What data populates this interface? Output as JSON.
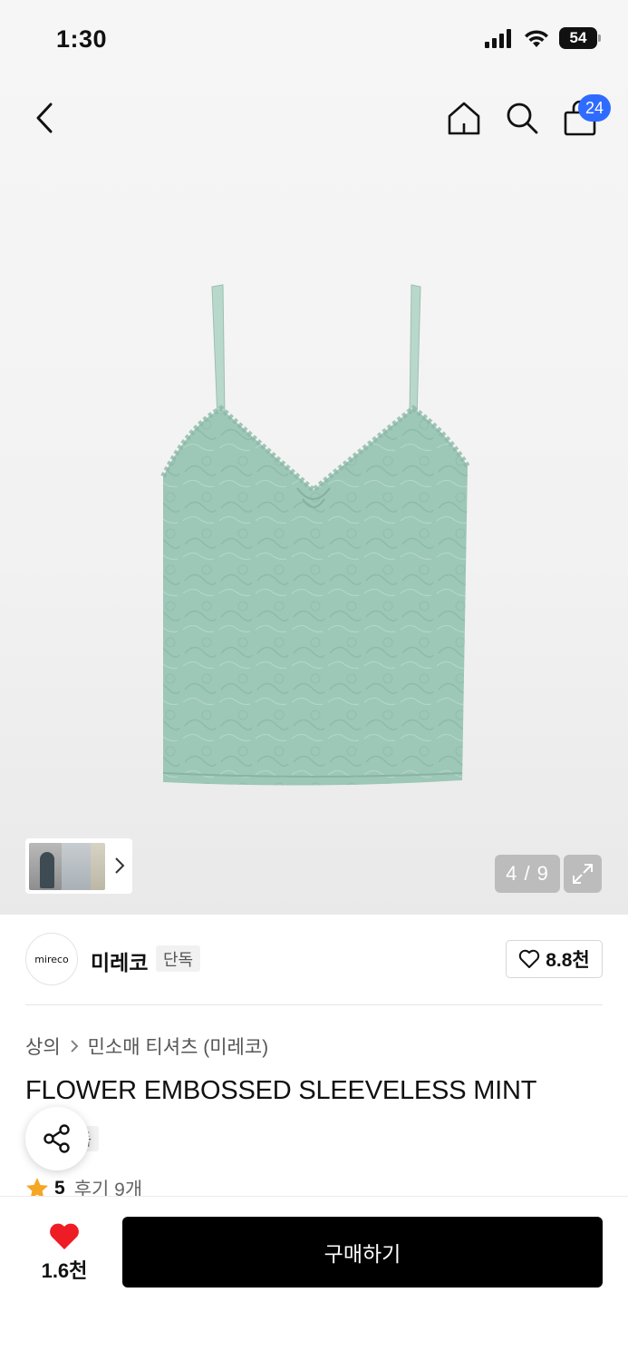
{
  "status_bar": {
    "time": "1:30",
    "battery": "54"
  },
  "header": {
    "cart_badge": "24"
  },
  "gallery": {
    "counter": "4 / 9"
  },
  "brand": {
    "logo_text": "mireco",
    "name": "미레코",
    "exclusive_label": "단독",
    "likes": "8.8천"
  },
  "breadcrumb": {
    "category": "상의",
    "subcategory": "민소매 티셔츠 (미레코)"
  },
  "product": {
    "title": "FLOWER EMBOSSED SLEEVELESS MINT",
    "exclusive_label": "단독",
    "rating": "5",
    "reviews": "후기 9개",
    "color": "#9dc7b6"
  },
  "bottom_bar": {
    "wish_count": "1.6천",
    "buy_label": "구매하기"
  },
  "colors": {
    "accent_badge": "#2f6bff",
    "heart": "#ee1c25",
    "star": "#f5a623"
  }
}
